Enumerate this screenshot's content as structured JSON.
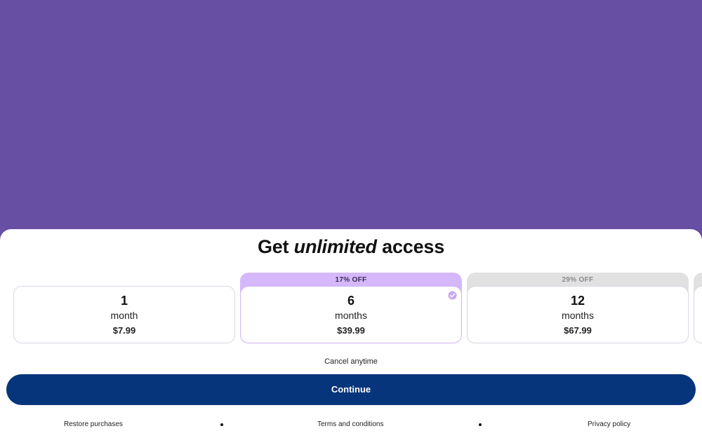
{
  "header": {
    "title_before": "Get ",
    "title_emphasis": "unlimited",
    "title_after": " access"
  },
  "plans": [
    {
      "badge": "",
      "quantity": "1",
      "unit": "month",
      "price": "$7.99",
      "selected": false
    },
    {
      "badge": "17% OFF",
      "quantity": "6",
      "unit": "months",
      "price": "$39.99",
      "selected": true
    },
    {
      "badge": "29% OFF",
      "quantity": "12",
      "unit": "months",
      "price": "$67.99",
      "selected": false
    }
  ],
  "cancel_text": "Cancel anytime",
  "continue_label": "Continue",
  "footer": {
    "restore": "Restore purchases",
    "terms": "Terms and conditions",
    "privacy": "Privacy policy"
  },
  "colors": {
    "hero_bg": "#6750a4",
    "primary": "#07357c",
    "selected_badge": "#d5b8fb",
    "selected_border": "#cfb3f5",
    "unselected_badge": "#e1e1e1"
  },
  "icons": {
    "selected_indicator": "check-circle-icon"
  }
}
